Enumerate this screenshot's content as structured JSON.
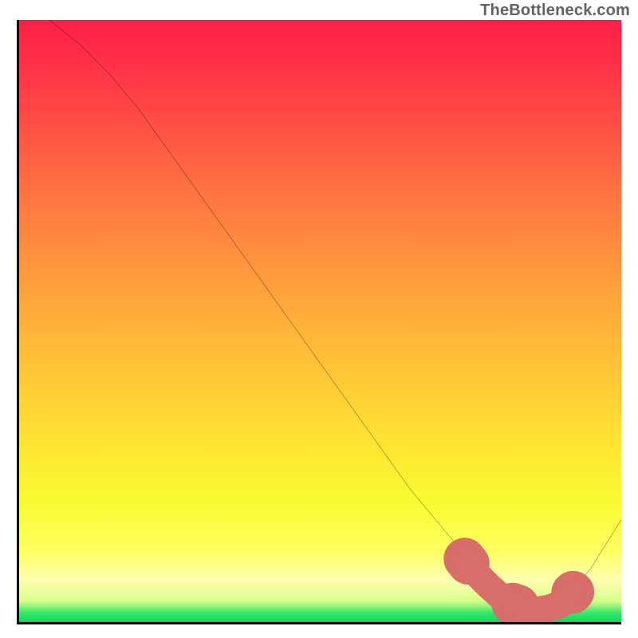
{
  "attribution": "TheBottleneck.com",
  "chart_data": {
    "type": "line",
    "title": "",
    "xlabel": "",
    "ylabel": "",
    "xlim": [
      0,
      100
    ],
    "ylim": [
      0,
      100
    ],
    "grid": false,
    "legend": false,
    "series": [
      {
        "name": "curve",
        "color": "#000000",
        "x": [
          5,
          10,
          15,
          20,
          25,
          30,
          35,
          40,
          45,
          50,
          55,
          60,
          65,
          70,
          75,
          80,
          82,
          85,
          90,
          95,
          100
        ],
        "values": [
          100,
          96,
          91,
          85,
          78,
          71,
          64,
          57,
          50,
          43,
          36,
          29,
          22,
          16,
          10,
          5,
          3,
          2,
          3,
          9,
          17
        ]
      },
      {
        "name": "marked-region",
        "color": "#d96d6a",
        "x": [
          74,
          76,
          78,
          80,
          82,
          84,
          86,
          88,
          90,
          92
        ],
        "values": [
          10.5,
          8,
          6,
          4.2,
          3,
          2.3,
          2.0,
          2.3,
          3.0,
          5
        ]
      }
    ],
    "background_gradient_stops": [
      {
        "pos": 0.0,
        "color": "#ff1f49"
      },
      {
        "pos": 0.1,
        "color": "#ff3847"
      },
      {
        "pos": 0.25,
        "color": "#ff6843"
      },
      {
        "pos": 0.4,
        "color": "#ff943e"
      },
      {
        "pos": 0.55,
        "color": "#ffbd38"
      },
      {
        "pos": 0.7,
        "color": "#ffe333"
      },
      {
        "pos": 0.8,
        "color": "#f8fb31"
      },
      {
        "pos": 0.88,
        "color": "#ffff60"
      },
      {
        "pos": 0.93,
        "color": "#ffffb0"
      },
      {
        "pos": 0.965,
        "color": "#d7ff8a"
      },
      {
        "pos": 0.985,
        "color": "#35e968"
      },
      {
        "pos": 1.0,
        "color": "#0fd65a"
      }
    ]
  }
}
